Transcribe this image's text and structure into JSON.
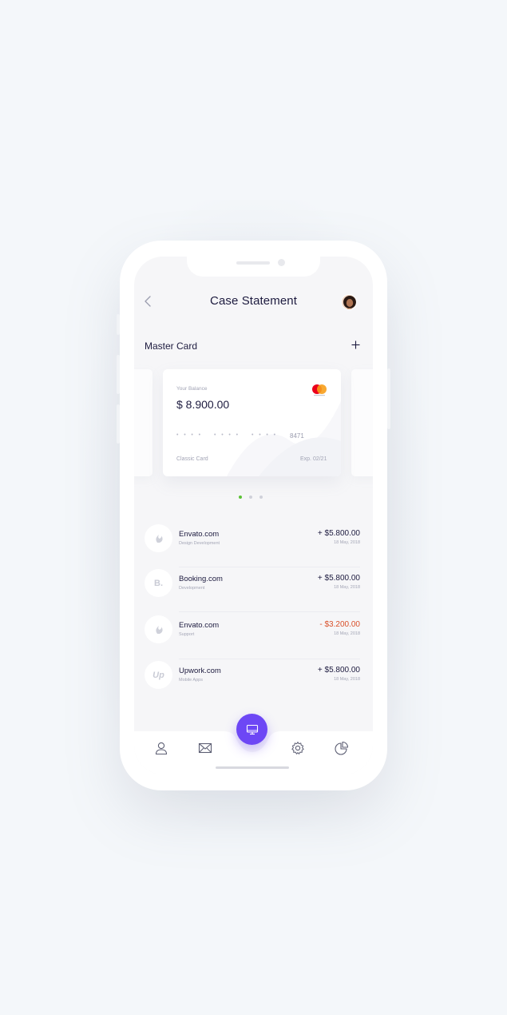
{
  "header": {
    "title": "Case Statement"
  },
  "section": {
    "title": "Master Card"
  },
  "card": {
    "balance_label": "Your Balance",
    "balance": "$ 8.900.00",
    "masked_groups": [
      "• • • •",
      "• • • •",
      "• • • •"
    ],
    "last4": "8471",
    "type": "Classic Card",
    "expiry": "Exp. 02/21"
  },
  "pager": {
    "count": 3,
    "active": 0
  },
  "transactions": [
    {
      "name": "Envato.com",
      "sub": "Design Development",
      "amount": "+ $5.800.00",
      "date": "18 May, 2018",
      "icon": "envato-leaf-icon",
      "negative": false
    },
    {
      "name": "Booking.com",
      "sub": "Development",
      "amount": "+ $5.800.00",
      "date": "18 May, 2018",
      "icon": "booking-logo-icon",
      "icon_text": "B.",
      "negative": false
    },
    {
      "name": "Envato.com",
      "sub": "Support",
      "amount": "- $3.200.00",
      "date": "18 May, 2018",
      "icon": "envato-leaf-icon",
      "negative": true
    },
    {
      "name": "Upwork.com",
      "sub": "Mobile Apps",
      "amount": "+ $5.800.00",
      "date": "18 May, 2018",
      "icon": "upwork-logo-icon",
      "icon_text": "Up",
      "negative": false
    }
  ],
  "tabbar": {
    "items": [
      "user-icon",
      "mail-icon",
      "monitor-icon",
      "gear-icon",
      "pie-chart-icon"
    ],
    "active": "monitor-icon"
  },
  "colors": {
    "accent": "#6d47f5",
    "negative": "#d9502a",
    "pager_active": "#5bc236",
    "text": "#1d1b3f"
  }
}
